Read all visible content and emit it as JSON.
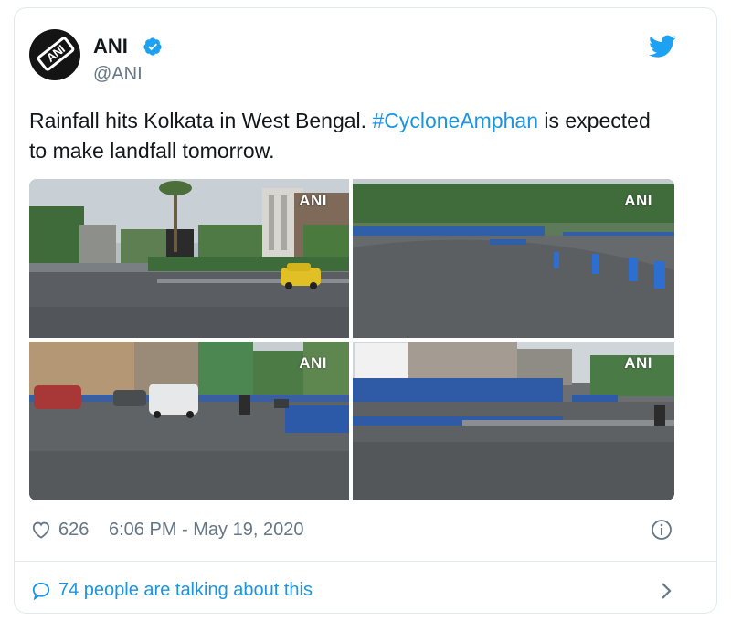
{
  "author": {
    "name": "ANI",
    "handle": "@ANI",
    "avatar_text": "ANI",
    "verified": true
  },
  "tweet": {
    "text_before": "Rainfall hits Kolkata in West Bengal. ",
    "hashtag": "#CycloneAmphan",
    "text_after": " is expected to make landfall tomorrow."
  },
  "media": {
    "watermark": "ANI",
    "photos": [
      {
        "scene": "yellow taxi on wet road with palm tree"
      },
      {
        "scene": "empty wet highway with blue barricades"
      },
      {
        "scene": "cars on rainy street with buildings"
      },
      {
        "scene": "wet empty road with blue railing"
      }
    ]
  },
  "footer": {
    "likes": "626",
    "timestamp": "6:06 PM - May 19, 2020"
  },
  "conversation": {
    "label": "74 people are talking about this"
  },
  "colors": {
    "accent": "#1b95e0",
    "muted": "#657786",
    "text": "#14171a",
    "border": "#e1e8ed"
  },
  "icons": {
    "brand": "twitter-bird-icon",
    "verified": "verified-badge-icon",
    "like": "heart-icon",
    "info": "info-icon",
    "reply": "speech-bubble-icon",
    "more": "chevron-right-icon"
  }
}
